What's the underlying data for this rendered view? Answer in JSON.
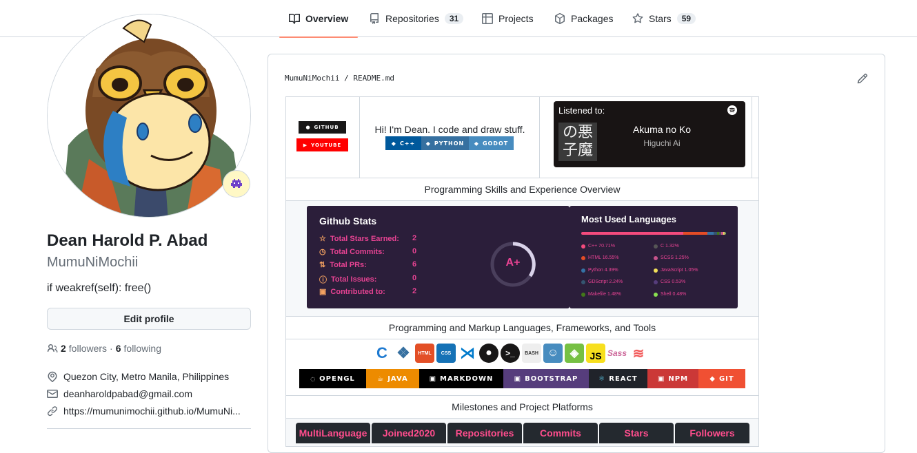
{
  "nav": {
    "tabs": [
      {
        "label": "Overview"
      },
      {
        "label": "Repositories",
        "count": "31"
      },
      {
        "label": "Projects"
      },
      {
        "label": "Packages"
      },
      {
        "label": "Stars",
        "count": "59"
      }
    ]
  },
  "profile": {
    "name": "Dean Harold P. Abad",
    "login": "MumuNiMochii",
    "bio": "if weakref(self): free()",
    "edit_label": "Edit profile",
    "followers_count": "2",
    "followers_label": "followers",
    "following_count": "6",
    "following_label": "following",
    "location": "Quezon City, Metro Manila, Philippines",
    "email": "deanharoldpabad@gmail.com",
    "website": "https://mumunimochii.github.io/MumuNi..."
  },
  "readme": {
    "path_owner": "MumuNiMochii",
    "path_sep": "/",
    "path_file": "README.md",
    "badges_social": [
      "GITHUB",
      "YOUTUBE"
    ],
    "intro": "Hi! I'm Dean. I code and draw stuff.",
    "badges_lang": [
      "C++",
      "PYTHON",
      "GODOT"
    ],
    "spotify": {
      "heading": "Listened to:",
      "track": "Akuma no Ko",
      "artist": "Higuchi Ai",
      "cover_text": "の悪子魔"
    },
    "section1": "Programming Skills and Experience Overview",
    "stats": {
      "title": "Github Stats",
      "rows": [
        {
          "label": "Total Stars Earned:",
          "value": "2"
        },
        {
          "label": "Total Commits:",
          "value": "0"
        },
        {
          "label": "Total PRs:",
          "value": "6"
        },
        {
          "label": "Total Issues:",
          "value": "0"
        },
        {
          "label": "Contributed to:",
          "value": "2"
        }
      ],
      "grade": "A+"
    },
    "languages": {
      "title": "Most Used Languages",
      "items": [
        {
          "label": "C++ 70.71%",
          "color": "#f34b7d"
        },
        {
          "label": "C 1.32%",
          "color": "#555555"
        },
        {
          "label": "HTML 16.55%",
          "color": "#e34c26"
        },
        {
          "label": "SCSS 1.25%",
          "color": "#c6538c"
        },
        {
          "label": "Python 4.39%",
          "color": "#3572A5"
        },
        {
          "label": "JavaScript 1.05%",
          "color": "#f1e05a"
        },
        {
          "label": "GDScript 2.24%",
          "color": "#355570"
        },
        {
          "label": "CSS 0.53%",
          "color": "#563d7c"
        },
        {
          "label": "Makefile 1.48%",
          "color": "#427819"
        },
        {
          "label": "Shell 0.48%",
          "color": "#89e051"
        }
      ]
    },
    "section2": "Programming and Markup Languages, Frameworks, and Tools",
    "tool_icons": [
      "HTML",
      "CSS",
      "BASH",
      "JS",
      "Sass"
    ],
    "tool_badges": [
      "OPENGL",
      "JAVA",
      "MARKDOWN",
      "BOOTSTRAP",
      "REACT",
      "NPM",
      "GIT"
    ],
    "section3": "Milestones and Project Platforms",
    "milestones": [
      "MultiLanguage",
      "Joined2020",
      "Repositories",
      "Commits",
      "Stars",
      "Followers"
    ]
  }
}
